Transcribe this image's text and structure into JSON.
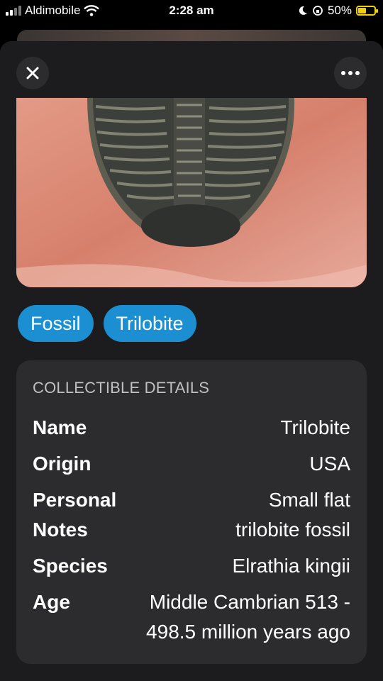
{
  "status_bar": {
    "carrier": "Aldimobile",
    "time": "2:28 am",
    "battery": "50%",
    "battery_level": 0.5
  },
  "toolbar": {
    "close_icon": "close-icon",
    "more_icon": "more-icon"
  },
  "photo": {
    "subject": "trilobite fossil held on fingertip"
  },
  "tags": [
    {
      "label": "Fossil"
    },
    {
      "label": "Trilobite"
    }
  ],
  "details": {
    "heading": "COLLECTIBLE DETAILS",
    "rows": [
      {
        "key": "Name",
        "value": "Trilobite"
      },
      {
        "key": "Origin",
        "value": "USA"
      },
      {
        "key": "Personal Notes",
        "value": "Small flat trilobite fossil"
      },
      {
        "key": "Species",
        "value": "Elrathia kingii"
      },
      {
        "key": "Age",
        "value": "Middle Cambrian 513 - 498.5 million years ago"
      }
    ]
  },
  "colors": {
    "accent": "#1b8fd1",
    "sheet": "#1c1c1e",
    "card": "#2c2c2e",
    "battery": "#f2d000"
  }
}
